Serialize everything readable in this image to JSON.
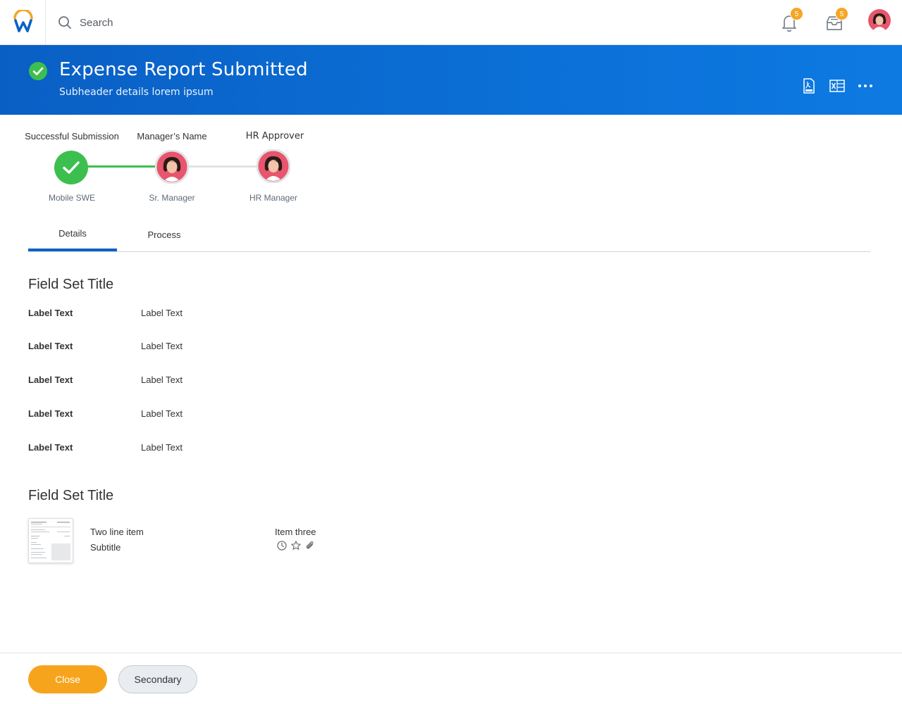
{
  "topbar": {
    "search_placeholder": "Search",
    "notifications_badge": "5",
    "inbox_badge": "5"
  },
  "banner": {
    "title": "Expense Report Submitted",
    "subtitle": "Subheader details lorem ipsum",
    "color": "#0b6fd6"
  },
  "process": {
    "steps": [
      {
        "title": "Successful Submission",
        "subtitle": "Mobile SWE",
        "status": "complete"
      },
      {
        "title": "Manager’s Name",
        "subtitle": "Sr. Manager",
        "status": "current"
      },
      {
        "title": "HR Approver",
        "subtitle": "HR Manager",
        "status": "pending"
      }
    ],
    "complete_color": "#3dbf4f"
  },
  "tabs": [
    {
      "label": "Details",
      "active": true
    },
    {
      "label": "Process",
      "active": false
    }
  ],
  "fieldset1": {
    "title": "Field Set Title",
    "rows": [
      {
        "label": "Label Text",
        "value": "Label Text"
      },
      {
        "label": "Label Text",
        "value": "Label Text"
      },
      {
        "label": "Label Text",
        "value": "Label Text"
      },
      {
        "label": "Label Text",
        "value": "Label Text"
      },
      {
        "label": "Label Text",
        "value": "Label Text"
      }
    ]
  },
  "fieldset2": {
    "title": "Field Set Title",
    "item": {
      "title": "Two line item",
      "subtitle": "Subtitle",
      "meta_label": "Item three",
      "meta_icons": [
        "clock-icon",
        "star-icon",
        "paperclip-icon"
      ]
    }
  },
  "footer": {
    "primary_label": "Close",
    "secondary_label": "Secondary",
    "primary_color": "#f7a41d"
  }
}
